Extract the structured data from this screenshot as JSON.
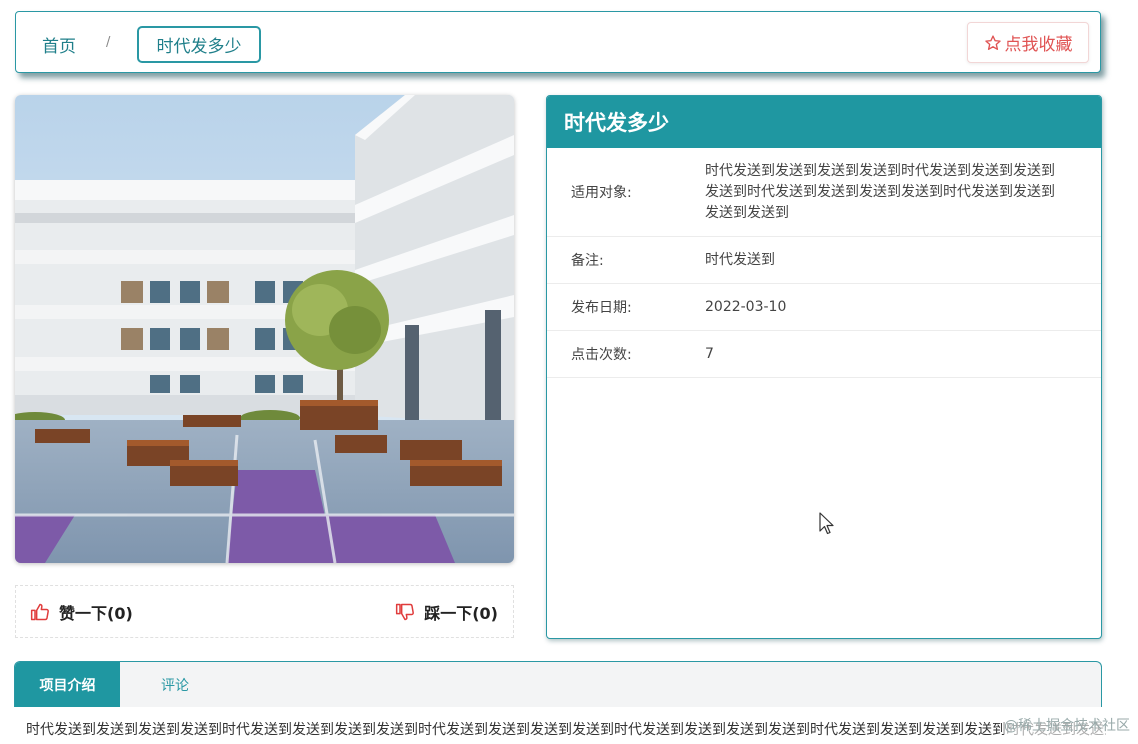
{
  "breadcrumb": {
    "home": "首页",
    "separator": "/",
    "current": "时代发多少"
  },
  "favorite": {
    "icon": "star-outline-icon",
    "label": "点我收藏"
  },
  "votes": {
    "like_icon": "thumbs-up-icon",
    "like_label": "赞一下(0)",
    "dislike_icon": "thumbs-down-icon",
    "dislike_label": "踩一下(0)"
  },
  "detail": {
    "title": "时代发多少",
    "rows": [
      {
        "label": "适用对象:",
        "value": "时代发送到发送到发送到发送到时代发送到发送到发送到发送到时代发送到发送到发送到发送到时代发送到发送到发送到发送到"
      },
      {
        "label": "备注:",
        "value": "时代发送到"
      },
      {
        "label": "发布日期:",
        "value": "2022-03-10"
      },
      {
        "label": "点击次数:",
        "value": "7"
      }
    ]
  },
  "tabs": [
    {
      "label": "项目介绍",
      "active": true
    },
    {
      "label": "评论",
      "active": false
    }
  ],
  "description": "时代发送到发送到发送到发送到时代发送到发送到发送到发送到时代发送到发送到发送到发送到时代发送到发送到发送到发送到时代发送到发送到发送到发送到时代发送到发送到发送到发送到",
  "watermark": "@稀土掘金技术社区",
  "colors": {
    "accent": "#1f97a1",
    "favorite": "#e05454",
    "vote_icon": "#e03c3c"
  }
}
